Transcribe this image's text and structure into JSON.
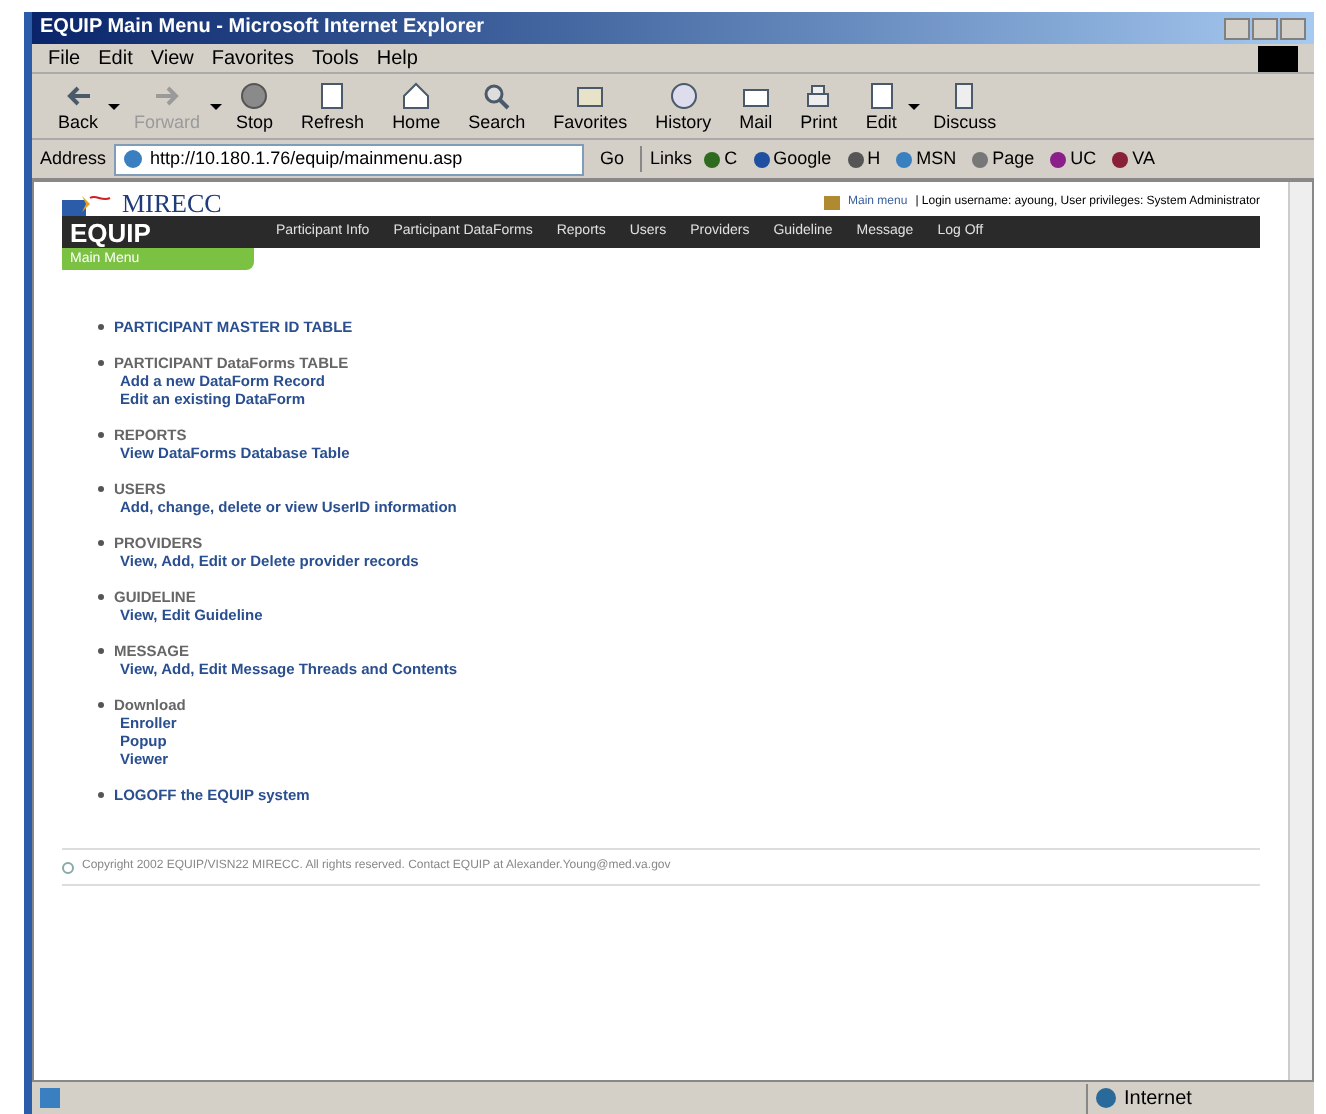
{
  "window": {
    "title": "EQUIP Main Menu - Microsoft Internet Explorer"
  },
  "menu": [
    "File",
    "Edit",
    "View",
    "Favorites",
    "Tools",
    "Help"
  ],
  "toolbar": [
    {
      "label": "Back",
      "disabled": false,
      "dropdown": true
    },
    {
      "label": "Forward",
      "disabled": true,
      "dropdown": true
    },
    {
      "label": "Stop",
      "disabled": false,
      "dropdown": false
    },
    {
      "label": "Refresh",
      "disabled": false,
      "dropdown": false
    },
    {
      "label": "Home",
      "disabled": false,
      "dropdown": false
    },
    {
      "label": "Search",
      "disabled": false,
      "dropdown": false
    },
    {
      "label": "Favorites",
      "disabled": false,
      "dropdown": false
    },
    {
      "label": "History",
      "disabled": false,
      "dropdown": false
    },
    {
      "label": "Mail",
      "disabled": false,
      "dropdown": false
    },
    {
      "label": "Print",
      "disabled": false,
      "dropdown": false
    },
    {
      "label": "Edit",
      "disabled": false,
      "dropdown": true
    },
    {
      "label": "Discuss",
      "disabled": false,
      "dropdown": false
    }
  ],
  "address": {
    "label": "Address",
    "value": "http://10.180.1.76/equip/mainmenu.asp",
    "go": "Go",
    "links_label": "Links"
  },
  "links": [
    {
      "label": "C",
      "color": "#2f6b1f"
    },
    {
      "label": "Google",
      "color": "#1f4fa0"
    },
    {
      "label": "H",
      "color": "#555555"
    },
    {
      "label": "MSN",
      "color": "#3a7fc0"
    },
    {
      "label": "Page",
      "color": "#777777"
    },
    {
      "label": "UC",
      "color": "#8a1f8a"
    },
    {
      "label": "VA",
      "color": "#8a1f3a"
    }
  ],
  "page": {
    "logo_top": "MIRECC",
    "logo_bottom": "EQUIP",
    "home_link": "Main menu",
    "login_info": "| Login username: ayoung, User privileges: System Administrator",
    "nav": [
      "Participant Info",
      "Participant DataForms",
      "Reports",
      "Users",
      "Providers",
      "Guideline",
      "Message",
      "Log Off"
    ],
    "active_tab": "Main Menu",
    "sections": [
      {
        "title": "PARTICIPANT MASTER ID TABLE",
        "link": true
      },
      {
        "title": "PARTICIPANT DataForms TABLE",
        "link": false,
        "items": [
          "Add a new DataForm Record",
          "Edit an existing DataForm"
        ]
      },
      {
        "title": "REPORTS",
        "link": false,
        "items": [
          "View DataForms Database Table"
        ]
      },
      {
        "title": "USERS",
        "link": false,
        "items": [
          "Add, change, delete or view UserID information"
        ]
      },
      {
        "title": "PROVIDERS",
        "link": false,
        "items": [
          "View, Add, Edit or Delete provider records"
        ]
      },
      {
        "title": "GUIDELINE",
        "link": false,
        "items": [
          "View, Edit Guideline"
        ]
      },
      {
        "title": "MESSAGE",
        "link": false,
        "items": [
          "View, Add, Edit Message Threads and Contents"
        ]
      },
      {
        "title": "Download",
        "link": false,
        "items": [
          "Enroller",
          "Popup",
          "Viewer"
        ]
      },
      {
        "title": "LOGOFF the EQUIP system",
        "link": true
      }
    ],
    "copyright": "Copyright 2002 EQUIP/VISN22 MIRECC. All rights reserved. Contact EQUIP at Alexander.Young@med.va.gov"
  },
  "status": {
    "zone": "Internet"
  }
}
